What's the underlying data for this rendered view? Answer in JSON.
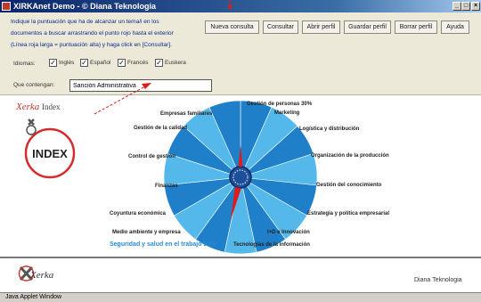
{
  "window": {
    "title": "XIRKAnet Demo - © Diana Teknologia",
    "min": "_",
    "max": "□",
    "close": "×"
  },
  "instructions": {
    "line1": "Indique la puntuación que ha de alcanzar un tema/i en los",
    "line2": "documentos a buscar arrastrando el punto rojo hasta el exterior",
    "line3": "(Línea roja larga = puntuación alta) y haga click en [Consultar]."
  },
  "toolbar": {
    "nueva_consulta": "Nueva consulta",
    "consultar": "Consultar",
    "abrir_perfil": "Abrir perfil",
    "guardar_perfil": "Guardar perfil",
    "borrar_perfil": "Borrar perfil",
    "ayuda": "Ayuda"
  },
  "languages": {
    "label": "Idiomas:",
    "items": [
      {
        "label": "Inglés",
        "checked": true
      },
      {
        "label": "Español",
        "checked": true
      },
      {
        "label": "Francés",
        "checked": true
      },
      {
        "label": "Euskera",
        "checked": true
      }
    ]
  },
  "search": {
    "label": "Que contengan:",
    "value": "Sanción Administrativa"
  },
  "logo": {
    "brand": "Xerka",
    "suffix": "Index",
    "badge": "INDEX"
  },
  "chart": {
    "labels": {
      "gestion_personas": "Gestión de personas 30%",
      "marketing": "Marketing",
      "logistica": "Logística y distribución",
      "organizacion": "Organización de la producción",
      "conocimiento": "Gestión del conocimiento",
      "estrategia": "Estrategia y política empresarial",
      "idi": "I+D e Innovación",
      "tecnologias": "Tecnologías de la información",
      "seguridad": "Seguridad y salud en el trabajo 50%",
      "medio_ambiente": "Medio ambiente y empresa",
      "coyuntura": "Coyuntura económica",
      "finanzas": "Finanzas",
      "control": "Control de gestión",
      "calidad": "Gestión de la calidad",
      "familiares": "Empresas familiares"
    },
    "colors": {
      "dark": "#1f7fc8",
      "light": "#54b8ea",
      "pointer": "#e01b1b"
    }
  },
  "footer": {
    "logo": "Xerka",
    "company": "Diana Teknologia"
  },
  "status": {
    "text": "Java Applet Window"
  }
}
